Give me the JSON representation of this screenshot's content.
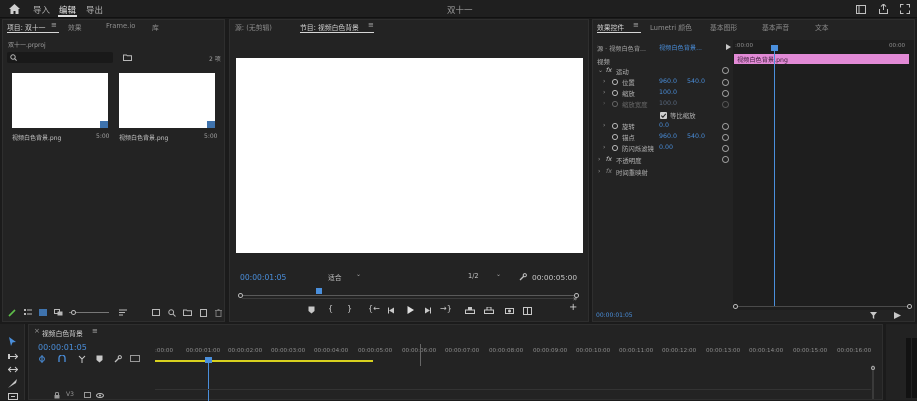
{
  "topbar": {
    "home_icon": "home-icon",
    "menu": [
      "导入",
      "编辑",
      "导出"
    ],
    "title": "双十一",
    "right_icons": [
      "workspace-icon",
      "share-icon",
      "fullscreen-icon"
    ]
  },
  "project_panel": {
    "tabs": [
      "项目: 双十一",
      "效果",
      "Frame.io",
      "库"
    ],
    "file_name": "双十一.prproj",
    "item_count": "2 项",
    "search_icon": "search-icon",
    "new_bin_icon": "folder-icon",
    "items": [
      {
        "name": "视频白色背景.png",
        "duration": "5:00"
      },
      {
        "name": "视频白色背景.png",
        "duration": "5:00"
      }
    ]
  },
  "source_panel": {
    "tabs": [
      "源: (无剪辑)",
      "节目: 视频白色背景"
    ]
  },
  "program_monitor": {
    "timecode": "00:00:01:05",
    "fit": "适合",
    "resolution": "1/2",
    "duration": "00:00:05:00"
  },
  "effects_panel": {
    "tabs": [
      "效果控件",
      "Lumetri 颜色",
      "基本图形",
      "基本声音",
      "文本"
    ],
    "source_label": "源 · 视频白色背...",
    "clip_label": "视频白色背景...",
    "section": "视频",
    "motion": "运动",
    "properties": [
      {
        "label": "位置",
        "v1": "960.0",
        "v2": "540.0"
      },
      {
        "label": "缩放",
        "v1": "100.0",
        "v2": ""
      },
      {
        "label": "缩放宽度",
        "v1": "100.0",
        "v2": ""
      },
      {
        "label": "等比缩放",
        "v1": "",
        "v2": ""
      },
      {
        "label": "旋转",
        "v1": "0.0",
        "v2": ""
      },
      {
        "label": "锚点",
        "v1": "960.0",
        "v2": "540.0"
      },
      {
        "label": "防闪烁滤镜",
        "v1": "0.00",
        "v2": ""
      }
    ],
    "opacity": "不透明度",
    "time_remap": "时间重映射",
    "mini_timeline_start": ":00:00",
    "mini_timeline_end": "00:00",
    "clip_bar_label": "视频白色背景.png",
    "bottom_timecode": "00:00:01:05"
  },
  "timeline": {
    "tab": "视频白色背景",
    "timecode": "00:00:01:05",
    "ruler": [
      ":00:00",
      "00:00:01:00",
      "00:00:02:00",
      "00:00:03:00",
      "00:00:04:00",
      "00:00:05:00",
      "00:00:06:00",
      "00:00:07:00",
      "00:00:08:00",
      "00:00:09:00",
      "00:00:10:00",
      "00:00:11:00",
      "00:00:12:00",
      "00:00:13:00",
      "00:00:14:00",
      "00:00:15:00",
      "00:00:16:00"
    ],
    "track_label": "V3"
  },
  "colors": {
    "accent": "#4a8fdc",
    "clip_pink": "#e28ad6",
    "work_area": "#d8d11f"
  }
}
